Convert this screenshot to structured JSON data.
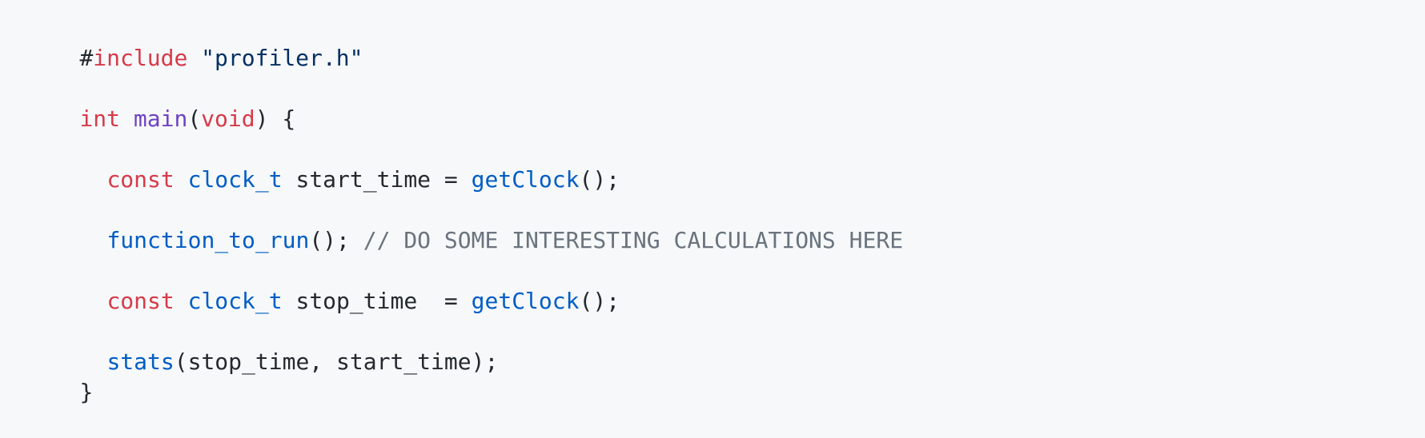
{
  "colors": {
    "background": "#f6f8fa",
    "plain": "#24292e",
    "keyword": "#d73a49",
    "string": "#032f62",
    "function": "#005cc5",
    "function_def": "#6f42c1",
    "comment": "#6a737d"
  },
  "code": {
    "l1": {
      "hash": "#",
      "include": "include",
      "space": " ",
      "header": "\"profiler.h\""
    },
    "l2": {
      "int": "int",
      "sp1": " ",
      "main": "main",
      "paren_open": "(",
      "void": "void",
      "rest": ") {"
    },
    "l3": {
      "const": "const",
      "sp1": " ",
      "type": "clock_t",
      "mid": " start_time = ",
      "fn": "getClock",
      "rest": "();"
    },
    "l4": {
      "fn": "function_to_run",
      "rest": "(); ",
      "comment": "// DO SOME INTERESTING CALCULATIONS HERE"
    },
    "l5": {
      "const": "const",
      "sp1": " ",
      "type": "clock_t",
      "mid": " stop_time  = ",
      "fn": "getClock",
      "rest": "();"
    },
    "l6": {
      "fn": "stats",
      "rest": "(stop_time, start_time);"
    },
    "l7": {
      "brace": "}"
    }
  }
}
